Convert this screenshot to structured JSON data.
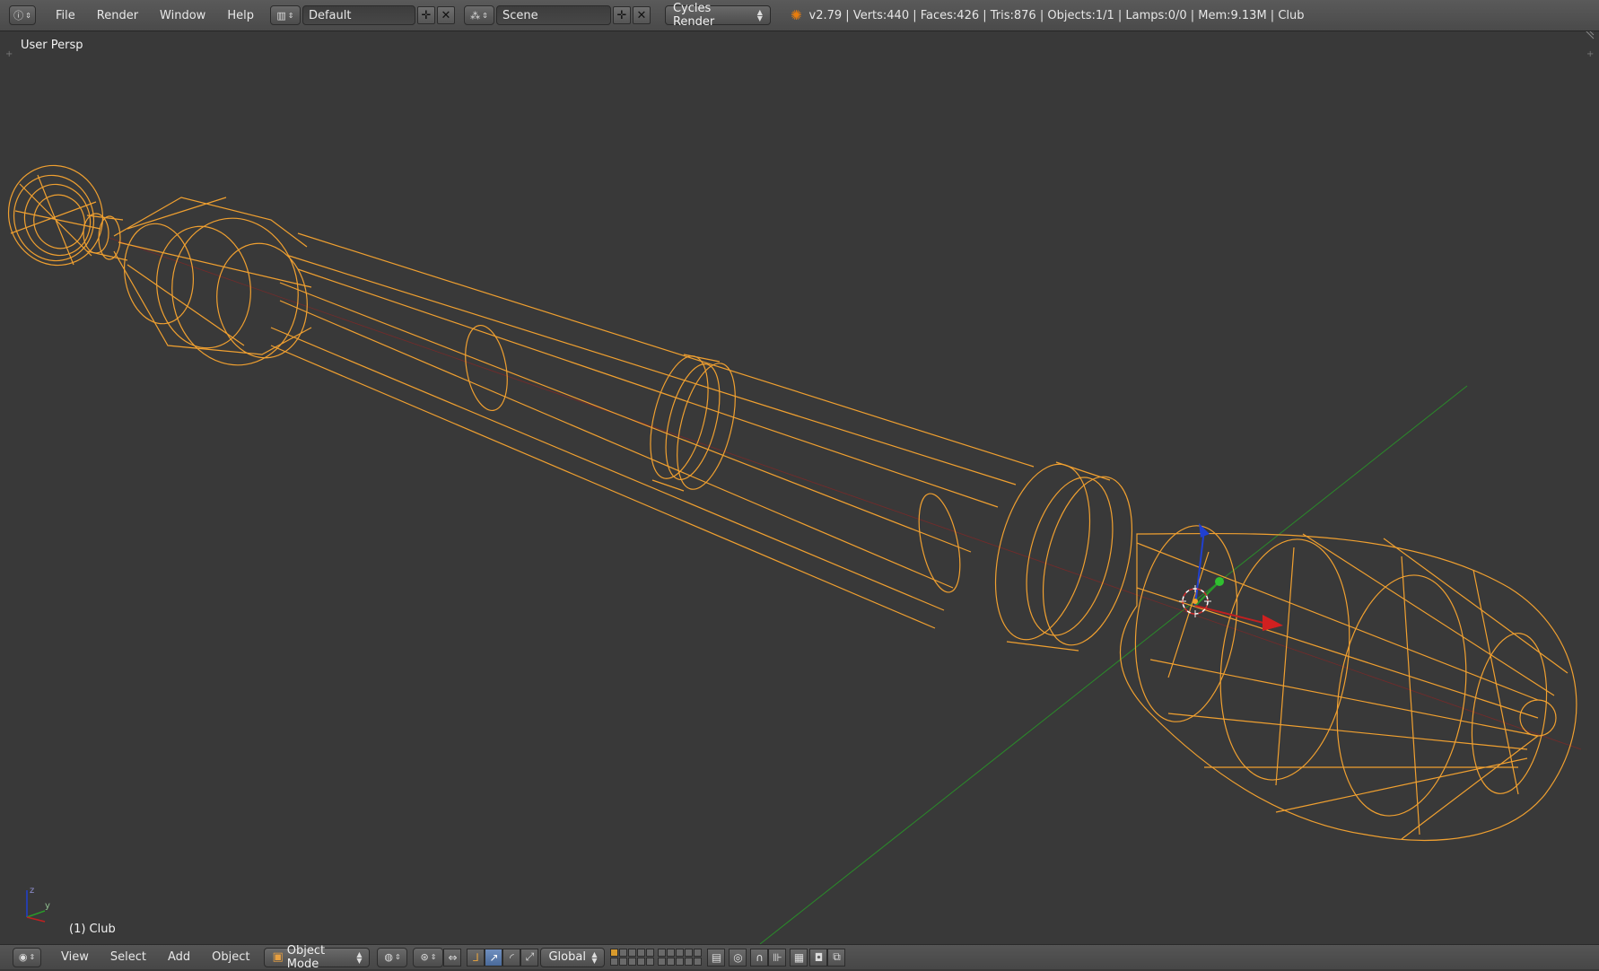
{
  "topbar": {
    "info_icon": "info-icon",
    "menus": [
      "File",
      "Render",
      "Window",
      "Help"
    ],
    "screen_layout": "Default",
    "scene": "Scene",
    "render_engine": "Cycles Render",
    "stats": "v2.79 | Verts:440 | Faces:426 | Tris:876 | Objects:1/1 | Lamps:0/0 | Mem:9.13M | Club"
  },
  "viewport": {
    "view_label": "User Persp",
    "object_label": "(1) Club",
    "axis_labels": {
      "x": "x",
      "y": "y",
      "z": "z"
    },
    "colors": {
      "background": "#393939",
      "wire": "#f0a030",
      "x_axis": "#c02020",
      "y_axis": "#2a8a2a",
      "z_axis": "#2040d0"
    }
  },
  "bottombar": {
    "menus": [
      "View",
      "Select",
      "Add",
      "Object"
    ],
    "mode": "Object Mode",
    "transform_orientation": "Global"
  }
}
